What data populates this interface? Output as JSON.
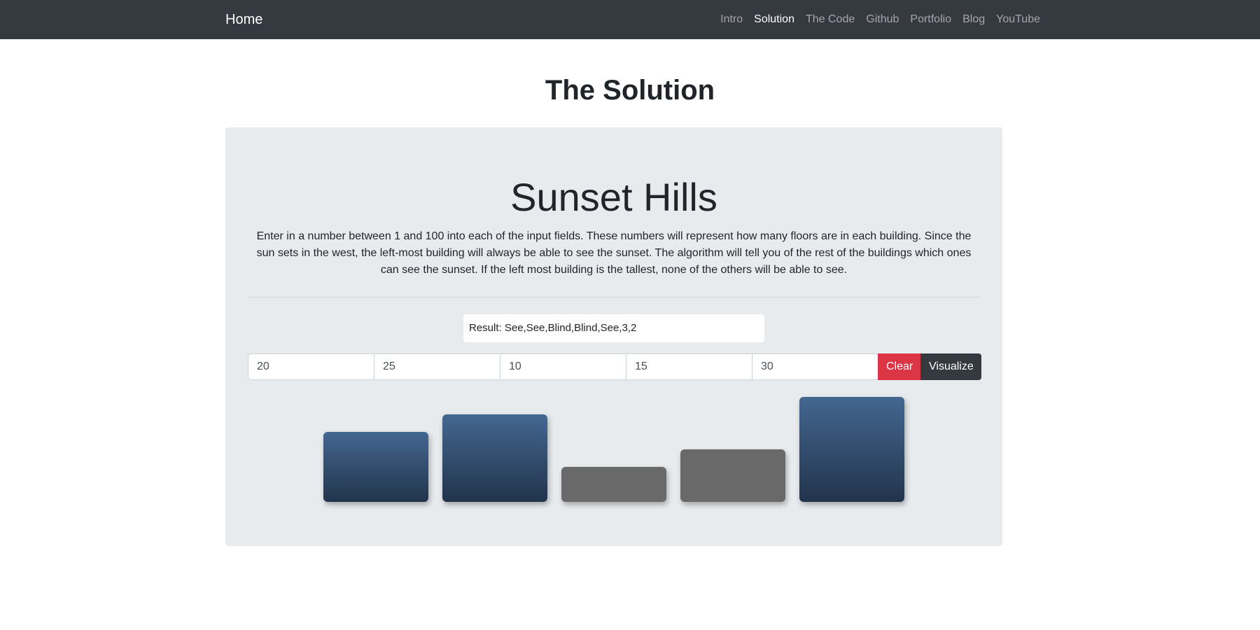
{
  "nav": {
    "brand": "Home",
    "links": [
      "Intro",
      "Solution",
      "The Code",
      "Github",
      "Portfolio",
      "Blog",
      "YouTube"
    ],
    "active": "Solution"
  },
  "page_title": "The Solution",
  "app": {
    "title": "Sunset Hills",
    "description": "Enter in a number between 1 and 100 into each of the input fields. These numbers will represent how many floors are in each building. Since the sun sets in the west, the left-most building will always be able to see the sunset. The algorithm will tell you of the rest of the buildings which ones can see the sunset. If the left most building is the tallest, none of the others will be able to see.",
    "result": "Result: See,See,Blind,Blind,See,3,2",
    "inputs": [
      "20",
      "25",
      "10",
      "15",
      "30"
    ],
    "clear_label": "Clear",
    "visualize_label": "Visualize"
  },
  "buildings": [
    {
      "floors": 20,
      "status": "See"
    },
    {
      "floors": 25,
      "status": "See"
    },
    {
      "floors": 10,
      "status": "Blind"
    },
    {
      "floors": 15,
      "status": "Blind"
    },
    {
      "floors": 30,
      "status": "See"
    }
  ],
  "colors": {
    "navbar": "#343a40",
    "see_top": "#436790",
    "see_bottom": "#22344c",
    "blind": "#696969",
    "clear": "#dc3545",
    "visualize": "#343a40"
  }
}
